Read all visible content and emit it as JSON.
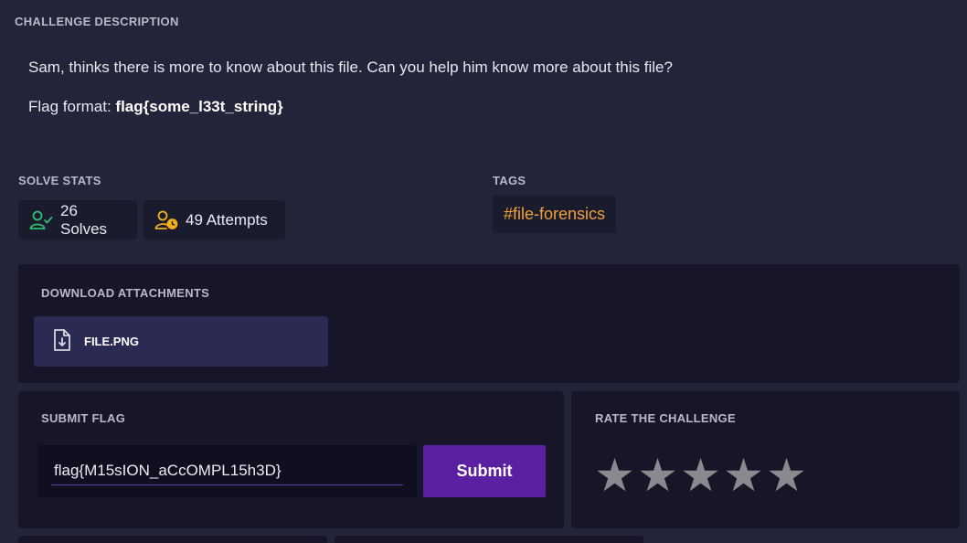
{
  "description": {
    "heading": "CHALLENGE DESCRIPTION",
    "body": "Sam, thinks there is more to know about this file. Can you help him know more about this file?",
    "flag_format_label": "Flag format: ",
    "flag_format_value": "flag{some_l33t_string}"
  },
  "solve_stats": {
    "heading": "SOLVE STATS",
    "solves": "26 Solves",
    "attempts": "49 Attempts",
    "solves_color": "#2fbf71",
    "attempts_color": "#f2b01e"
  },
  "tags": {
    "heading": "TAGS",
    "items": [
      "#file-forensics"
    ]
  },
  "attachments": {
    "heading": "DOWNLOAD ATTACHMENTS",
    "files": [
      "FILE.PNG"
    ]
  },
  "submit_flag": {
    "heading": "SUBMIT FLAG",
    "value": "flag{M15sION_aCcOMPL15h3D}",
    "button_label": "Submit"
  },
  "rating": {
    "heading": "RATE THE CHALLENGE",
    "stars": 5,
    "selected": 0,
    "star_glyph": "★"
  },
  "colors": {
    "background": "#23233a",
    "panel": "#161628",
    "accent": "#5b1fa2",
    "tag": "#f0a23a"
  }
}
